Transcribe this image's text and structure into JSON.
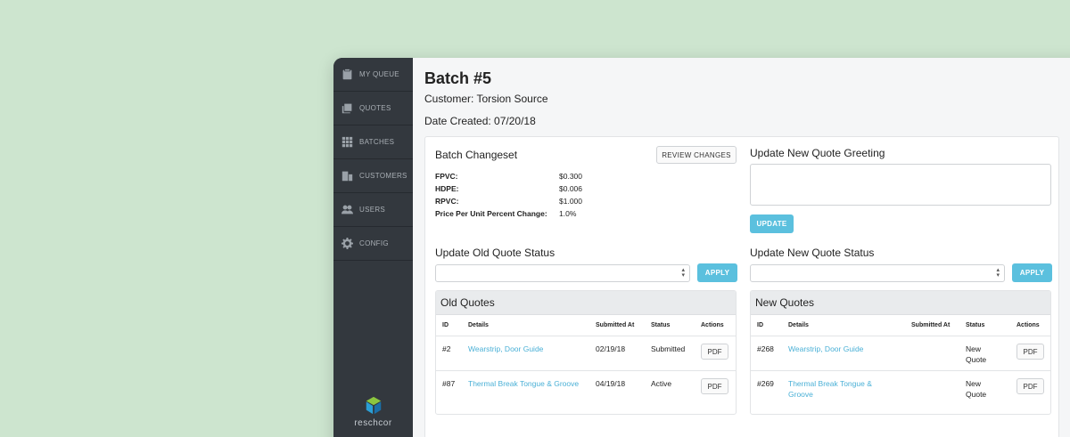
{
  "sidebar": {
    "items": [
      {
        "label": "MY QUEUE",
        "icon": "clipboard-icon"
      },
      {
        "label": "QUOTES",
        "icon": "documents-icon"
      },
      {
        "label": "BATCHES",
        "icon": "grid-icon"
      },
      {
        "label": "CUSTOMERS",
        "icon": "building-icon"
      },
      {
        "label": "USERS",
        "icon": "users-icon"
      },
      {
        "label": "CONFIG",
        "icon": "gear-icon"
      }
    ],
    "logo_text": "reschcor"
  },
  "header": {
    "title": "Batch #5",
    "customer": "Customer: Torsion Source",
    "date_created": "Date Created: 07/20/18"
  },
  "changeset": {
    "title": "Batch Changeset",
    "review_label": "REVIEW CHANGES",
    "rows": [
      {
        "key": "FPVC:",
        "value": "$0.300"
      },
      {
        "key": "HDPE:",
        "value": "$0.006"
      },
      {
        "key": "RPVC:",
        "value": "$1.000"
      },
      {
        "key": "Price Per Unit Percent Change:",
        "value": "1.0%"
      }
    ]
  },
  "greeting": {
    "title": "Update New Quote Greeting",
    "value": "",
    "update_label": "UPDATE"
  },
  "old_status": {
    "title": "Update Old Quote Status",
    "selected": "",
    "apply_label": "APPLY"
  },
  "new_status": {
    "title": "Update New Quote Status",
    "selected": "",
    "apply_label": "APPLY"
  },
  "old_quotes": {
    "title": "Old Quotes",
    "columns": [
      "ID",
      "Details",
      "Submitted At",
      "Status",
      "Actions"
    ],
    "rows": [
      {
        "id": "#2",
        "details": "Wearstrip, Door Guide",
        "submitted": "02/19/18",
        "status": "Submitted",
        "action": "PDF"
      },
      {
        "id": "#87",
        "details": "Thermal Break Tongue & Groove",
        "submitted": "04/19/18",
        "status": "Active",
        "action": "PDF"
      }
    ]
  },
  "new_quotes": {
    "title": "New Quotes",
    "columns": [
      "ID",
      "Details",
      "Submitted At",
      "Status",
      "Actions"
    ],
    "rows": [
      {
        "id": "#268",
        "details": "Wearstrip, Door Guide",
        "submitted": "",
        "status": "New Quote",
        "action": "PDF"
      },
      {
        "id": "#269",
        "details": "Thermal Break Tongue & Groove",
        "submitted": "",
        "status": "New Quote",
        "action": "PDF"
      }
    ]
  },
  "colors": {
    "background": "#cde5cf",
    "sidebar": "#33383e",
    "accent": "#5bc0de",
    "link": "#4ab0d6"
  }
}
